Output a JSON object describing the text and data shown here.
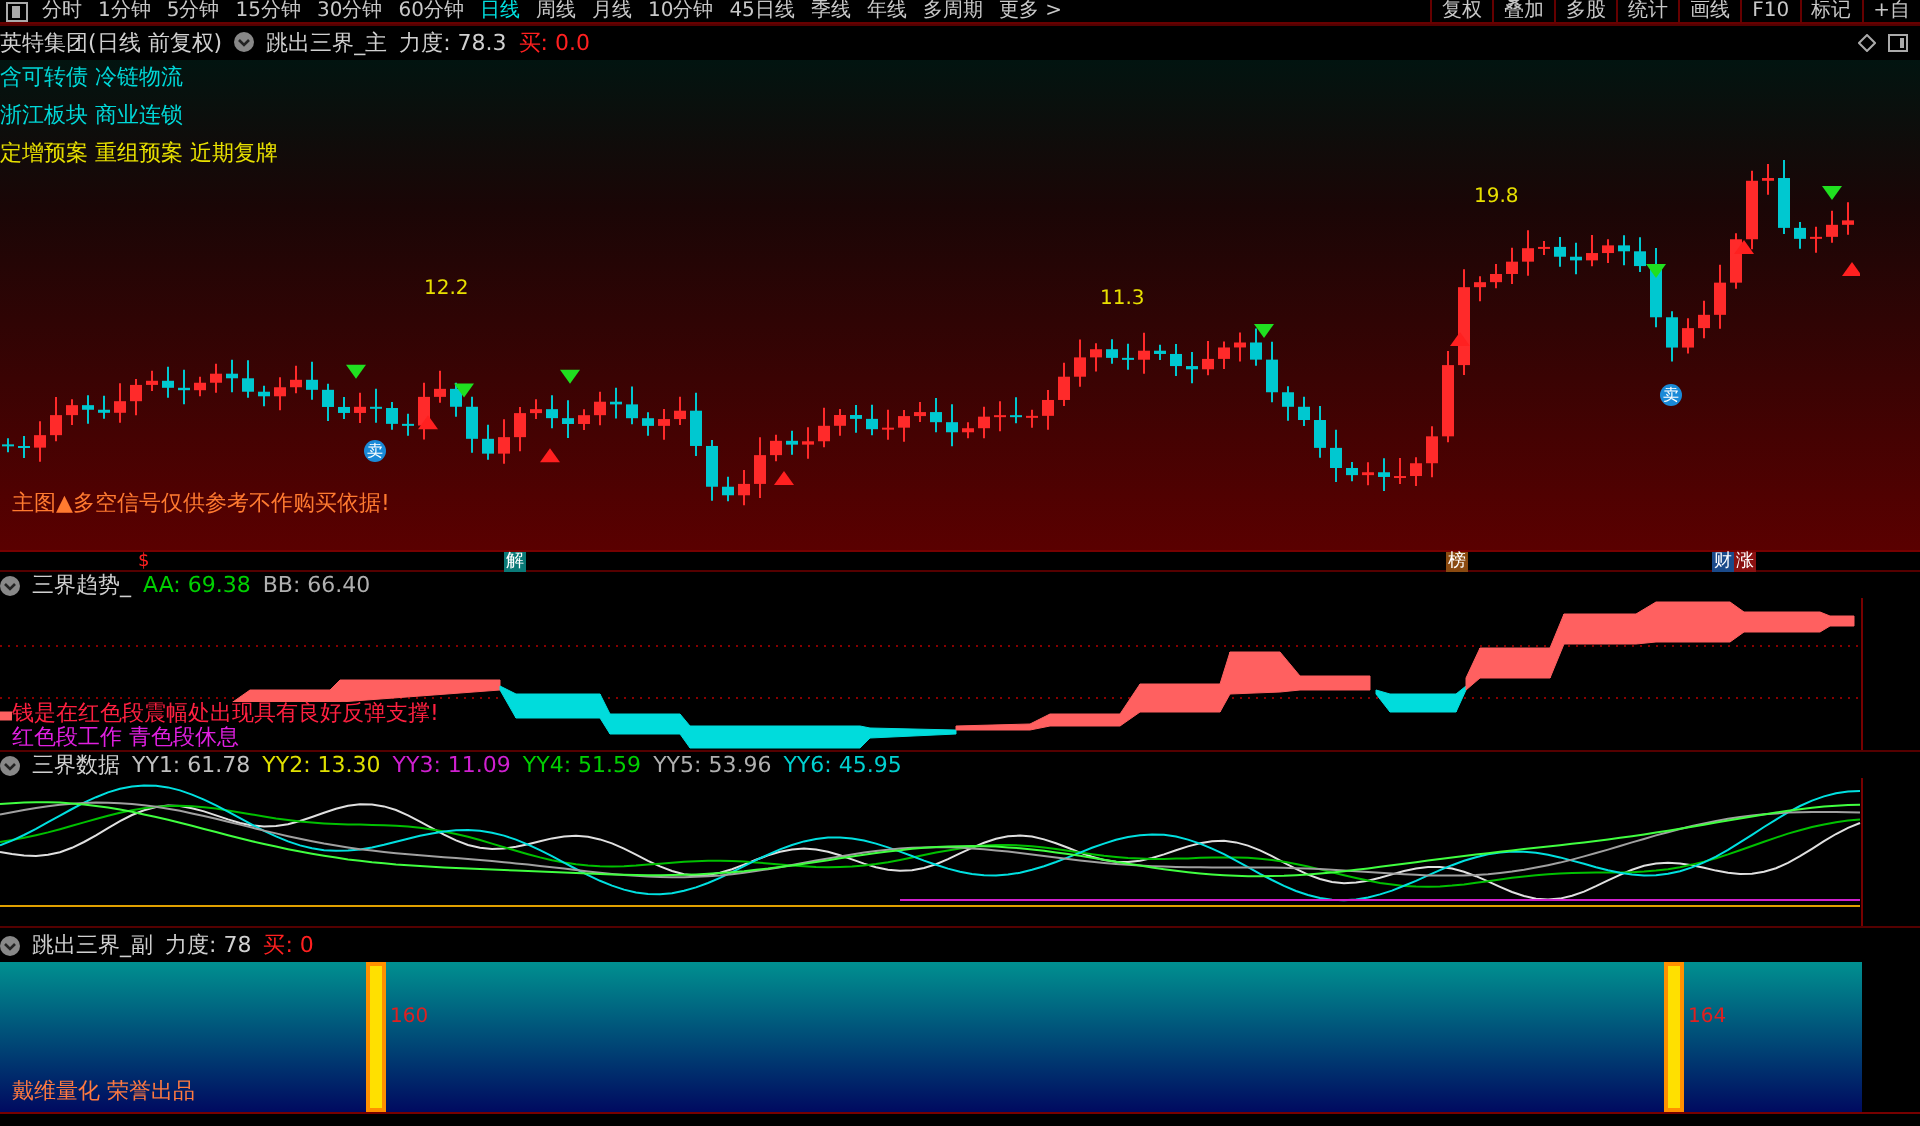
{
  "toolbar": {
    "periods": [
      {
        "label": "分时",
        "selected": false
      },
      {
        "label": "1分钟",
        "selected": false
      },
      {
        "label": "5分钟",
        "selected": false
      },
      {
        "label": "15分钟",
        "selected": false
      },
      {
        "label": "30分钟",
        "selected": false
      },
      {
        "label": "60分钟",
        "selected": false
      },
      {
        "label": "日线",
        "selected": true
      },
      {
        "label": "周线",
        "selected": false
      },
      {
        "label": "月线",
        "selected": false
      },
      {
        "label": "10分钟",
        "selected": false
      },
      {
        "label": "45日线",
        "selected": false
      },
      {
        "label": "季线",
        "selected": false
      },
      {
        "label": "年线",
        "selected": false
      },
      {
        "label": "多周期",
        "selected": false
      }
    ],
    "more": "更多 >",
    "actions": [
      "复权",
      "叠加",
      "多股",
      "统计",
      "画线",
      "F10",
      "标记",
      "+自"
    ]
  },
  "main_panel": {
    "title": "英特集团(日线 前复权)",
    "indicator": "跳出三界_主",
    "strength": "力度: 78.3",
    "buy": "买: 0.0",
    "tags": [
      {
        "text": "含可转债 冷链物流",
        "color": "#00d8d8"
      },
      {
        "text": "浙江板块  商业连锁",
        "color": "#00d8d8"
      },
      {
        "text": "定增预案 重组预案 近期复牌",
        "color": "#e8e000"
      }
    ],
    "price_labels": [
      "12.2",
      "11.3",
      "19.8"
    ],
    "sell_marks": [
      "卖",
      "卖"
    ],
    "disclaimer": "主图▲多空信号仅供参考不作购买依据!"
  },
  "event_markers": [
    {
      "label": "$",
      "kind": "symbol",
      "color": "#ff2020"
    },
    {
      "label": "解",
      "kind": "badge",
      "color": "#0a7a78"
    },
    {
      "label": "榜",
      "kind": "badge",
      "color": "#8a4a10"
    },
    {
      "label": "财",
      "kind": "badge",
      "color": "#1a4a8a"
    },
    {
      "label": "涨",
      "kind": "badge",
      "color": "#8a1010"
    }
  ],
  "trend_panel": {
    "title": "三界趋势_",
    "values": [
      {
        "text": "AA: 69.38",
        "color": "#00d000"
      },
      {
        "text": "BB: 66.40",
        "color": "#b0b0b0"
      }
    ],
    "notes": [
      {
        "text": "钱是在红色段震幅处出现具有良好反弹支撑!",
        "color": "#ff2040"
      },
      {
        "text": "红色段工作 青色段休息",
        "color": "#e020e0"
      }
    ]
  },
  "data_panel": {
    "title": "三界数据",
    "values": [
      {
        "text": "YY1: 61.78",
        "color": "#c0c0c0"
      },
      {
        "text": "YY2: 13.30",
        "color": "#e0e000"
      },
      {
        "text": "YY3: 11.09",
        "color": "#d020d0"
      },
      {
        "text": "YY4: 51.59",
        "color": "#00d000"
      },
      {
        "text": "YY5: 53.96",
        "color": "#b0b0b0"
      },
      {
        "text": "YY6: 45.95",
        "color": "#00d0d0"
      }
    ]
  },
  "sub_panel": {
    "indicator": "跳出三界_副",
    "strength": "力度: 78",
    "buy": "买: 0",
    "bar_labels": [
      "160",
      "164"
    ],
    "credit": "戴维量化 荣誉出品"
  }
}
